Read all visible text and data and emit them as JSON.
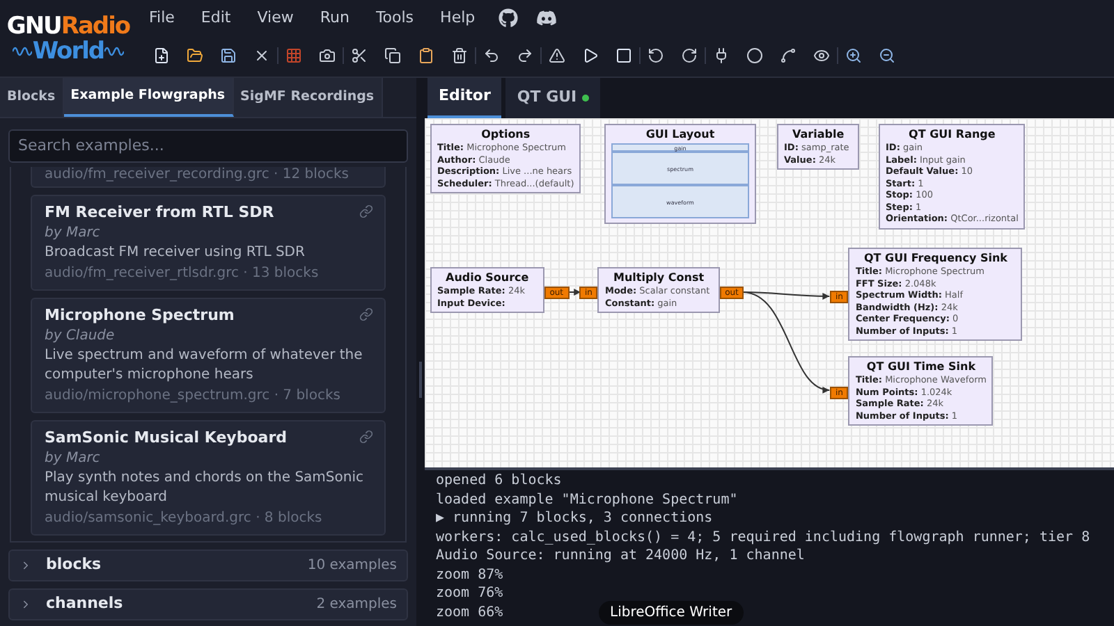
{
  "logo": {
    "first": "GNU",
    "second": "Radio",
    "third": "World"
  },
  "menu": [
    "File",
    "Edit",
    "View",
    "Run",
    "Tools",
    "Help"
  ],
  "sidebar": {
    "tabs": [
      {
        "label": "Blocks",
        "selected": false
      },
      {
        "label": "Example Flowgraphs",
        "selected": true
      },
      {
        "label": "SigMF Recordings",
        "selected": false
      }
    ],
    "search": {
      "placeholder": "Search examples..."
    },
    "examples": [
      {
        "kind": "clipped",
        "path": "audio/fm_receiver_recording.grc · 12 blocks"
      },
      {
        "kind": "card",
        "title": "FM Receiver from RTL SDR",
        "author": "by Marc",
        "description": "Broadcast FM receiver using RTL SDR",
        "path": "audio/fm_receiver_rtlsdr.grc · 13 blocks"
      },
      {
        "kind": "card",
        "title": "Microphone Spectrum",
        "author": "by Claude",
        "description": "Live spectrum and waveform of whatever the computer's microphone hears",
        "path": "audio/microphone_spectrum.grc · 7 blocks"
      },
      {
        "kind": "card",
        "title": "SamSonic Musical Keyboard",
        "author": "by Marc",
        "description": "Play synth notes and chords on the SamSonic musical keyboard",
        "path": "audio/samsonic_keyboard.grc · 8 blocks"
      }
    ],
    "groups": [
      {
        "name": "blocks",
        "count": "10 examples",
        "expanded": false
      },
      {
        "name": "channels",
        "count": "2 examples",
        "expanded": false
      }
    ]
  },
  "editor": {
    "tabs": [
      {
        "label": "Editor",
        "selected": true,
        "running": false
      },
      {
        "label": "QT GUI",
        "selected": false,
        "running": true
      }
    ],
    "blocks": [
      {
        "kind": "block",
        "title": "Options",
        "params": [
          {
            "label": "Title:",
            "value": "Microphone Spectrum"
          },
          {
            "label": "Author:",
            "value": "Claude"
          },
          {
            "label": "Description:",
            "value": "Live ...ne hears"
          },
          {
            "label": "Scheduler:",
            "value": "Thread...(default)"
          }
        ]
      },
      {
        "kind": "layout",
        "title": "GUI Layout",
        "areas": [
          "gain",
          "spectrum",
          "waveform"
        ]
      },
      {
        "kind": "block",
        "title": "Variable",
        "params": [
          {
            "label": "ID:",
            "value": "samp_rate"
          },
          {
            "label": "Value:",
            "value": "24k"
          }
        ]
      },
      {
        "kind": "block",
        "title": "QT GUI Range",
        "params": [
          {
            "label": "ID:",
            "value": "gain"
          },
          {
            "label": "Label:",
            "value": "Input gain"
          },
          {
            "label": "Default Value:",
            "value": "10"
          },
          {
            "label": "Start:",
            "value": "1"
          },
          {
            "label": "Stop:",
            "value": "100"
          },
          {
            "label": "Step:",
            "value": "1"
          },
          {
            "label": "Orientation:",
            "value": "QtCor...rizontal"
          }
        ]
      },
      {
        "kind": "block",
        "title": "Audio Source",
        "out": "out",
        "params": [
          {
            "label": "Sample Rate:",
            "value": "24k"
          },
          {
            "label": "Input Device:"
          }
        ]
      },
      {
        "kind": "block",
        "title": "Multiply Const",
        "in": "in",
        "out": "out",
        "params": [
          {
            "label": "Mode:",
            "value": "Scalar constant"
          },
          {
            "label": "Constant:",
            "value": "gain"
          }
        ]
      },
      {
        "kind": "block",
        "title": "QT GUI Frequency Sink",
        "in": "in",
        "params": [
          {
            "label": "Title:",
            "value": "Microphone Spectrum"
          },
          {
            "label": "FFT Size:",
            "value": "2.048k"
          },
          {
            "label": "Spectrum Width:",
            "value": "Half"
          },
          {
            "label": "Bandwidth (Hz):",
            "value": "24k"
          },
          {
            "label": "Center Frequency:",
            "value": "0"
          },
          {
            "label": "Number of Inputs:",
            "value": "1"
          }
        ]
      },
      {
        "kind": "block",
        "title": "QT GUI Time Sink",
        "in": "in",
        "params": [
          {
            "label": "Title:",
            "value": "Microphone Waveform"
          },
          {
            "label": "Num Points:",
            "value": "1.024k"
          },
          {
            "label": "Sample Rate:",
            "value": "24k"
          },
          {
            "label": "Number of Inputs:",
            "value": "1"
          }
        ]
      }
    ]
  },
  "console": [
    "opened 6 blocks",
    "loaded example \"Microphone Spectrum\"",
    "▶ running 7 blocks, 3 connections",
    "workers: calc_used_blocks() = 4; 5 required including flowgraph runner; tier 8",
    "Audio Source: running at 24000 Hz, 1 channel",
    "zoom 87%",
    "zoom 76%",
    "zoom 66%"
  ],
  "tooltip": "LibreOffice Writer"
}
